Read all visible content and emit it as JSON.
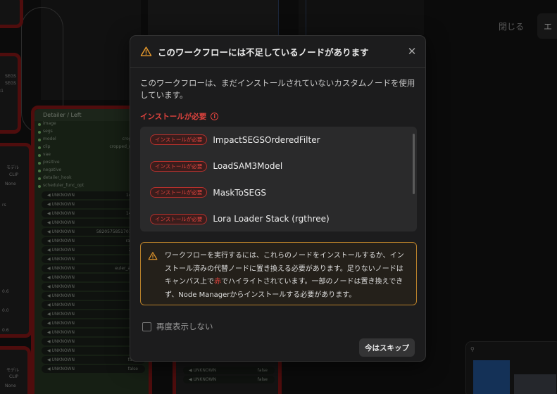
{
  "dialog": {
    "title": "このワークフローには不足しているノードがあります",
    "description": "このワークフローは、まだインストールされていないカスタムノードを使用しています。",
    "section_label": "インストールが必要",
    "missing_nodes": [
      {
        "badge": "インストールが必要",
        "name": "ImpactSEGSOrderedFilter"
      },
      {
        "badge": "インストールが必要",
        "name": "LoadSAM3Model"
      },
      {
        "badge": "インストールが必要",
        "name": "MaskToSEGS"
      },
      {
        "badge": "インストールが必要",
        "name": "Lora Loader Stack (rgthree)"
      }
    ],
    "alert": {
      "before_red": "ワークフローを実行するには、これらのノードをインストールするか、インストール済みの代替ノードに置き換える必要があります。足りないノードはキャンバス上で",
      "red_word": "赤",
      "after_red": "でハイライトされています。一部のノードは置き換えできず、Node Managerからインストールする必要があります。"
    },
    "checkbox_label": "再度表示しない",
    "checkbox_checked": false,
    "skip_button": "今はスキップ",
    "accent_red": "#e0433e",
    "warning_color": "#e89a2c"
  },
  "background": {
    "close_label": "閉じる",
    "edge_button": "エ",
    "detailer_node": {
      "title": "Detailer / Left",
      "ports": [
        "image",
        "segs",
        "model",
        "clip",
        "vae",
        "positive",
        "negative",
        "detailer_hook",
        "scheduler_func_opt"
      ],
      "port_values": [
        "",
        "cr",
        "cropped_re",
        "cropped_refined_",
        "cnet_i",
        "",
        "",
        "",
        ""
      ],
      "widgets": [
        {
          "label": "UNKNOWN",
          "value": "1408."
        },
        {
          "label": "UNKNOWN",
          "value": "tr"
        },
        {
          "label": "UNKNOWN",
          "value": "1408."
        },
        {
          "label": "UNKNOWN",
          "value": "tr"
        },
        {
          "label": "UNKNOWN",
          "value": "58205758517016.0"
        },
        {
          "label": "UNKNOWN",
          "value": "rando"
        },
        {
          "label": "UNKNOWN",
          "value": "20.0"
        },
        {
          "label": "UNKNOWN",
          "value": "5.0"
        },
        {
          "label": "UNKNOWN",
          "value": "euler_ance"
        },
        {
          "label": "UNKNOWN",
          "value": "n"
        },
        {
          "label": "UNKNOWN",
          "value": "0.5"
        },
        {
          "label": "UNKNOWN",
          "value": "5.0"
        },
        {
          "label": "UNKNOWN",
          "value": "tr"
        },
        {
          "label": "UNKNOWN",
          "value": "tr"
        },
        {
          "label": "UNKNOWN",
          "value": "n"
        },
        {
          "label": "UNKNOWN",
          "value": "1.0"
        },
        {
          "label": "UNKNOWN",
          "value": "fals"
        },
        {
          "label": "UNKNOWN",
          "value": "5.0"
        },
        {
          "label": "UNKNOWN",
          "value": "false"
        },
        {
          "label": "UNKNOWN",
          "value": "false"
        }
      ]
    },
    "second_node_widgets": [
      {
        "label": "UNKNOWN",
        "value": "false"
      },
      {
        "label": "UNKNOWN",
        "value": "false"
      }
    ],
    "left_fragments": [
      "SEGS",
      "SEGS",
      "x1",
      "モデル",
      "CLIP",
      "None",
      "rs",
      "0.6",
      "0.0",
      "0.6",
      "None",
      "0.6",
      "None",
      "モデル",
      "CLIP",
      "None"
    ]
  }
}
